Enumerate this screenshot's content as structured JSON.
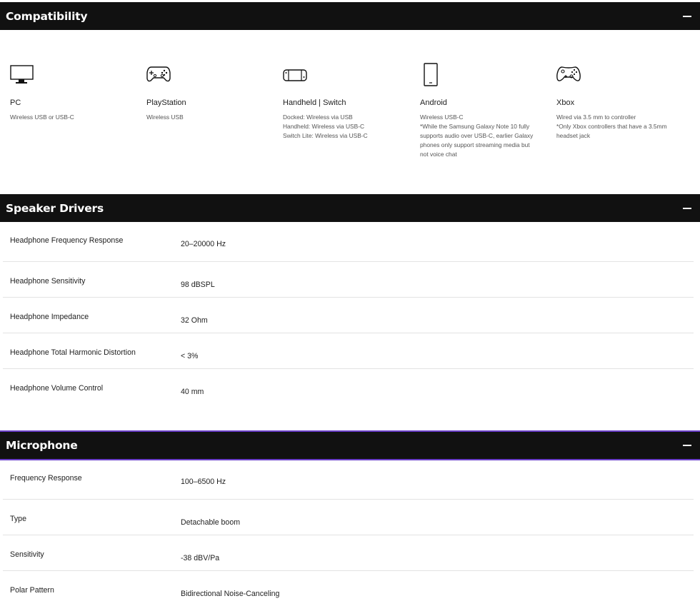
{
  "compatibility": {
    "title": "Compatibility",
    "items": [
      {
        "icon": "monitor-icon",
        "name": "PC",
        "desc": [
          "Wireless USB or USB-C"
        ]
      },
      {
        "icon": "gamepad-icon",
        "name": "PlayStation",
        "desc": [
          "Wireless USB"
        ]
      },
      {
        "icon": "handheld-console-icon",
        "name": "Handheld | Switch",
        "desc": [
          "Docked: Wireless via USB",
          "Handheld: Wireless via USB-C",
          "Switch Lite: Wireless via USB-C"
        ]
      },
      {
        "icon": "smartphone-icon",
        "name": "Android",
        "desc": [
          "Wireless USB-C",
          "*While the Samsung Galaxy Note 10 fully",
          "supports audio over USB-C, earlier Galaxy",
          "phones only support streaming media but",
          "not voice chat"
        ]
      },
      {
        "icon": "xbox-controller-icon",
        "name": "Xbox",
        "desc": [
          "Wired via 3.5 mm to controller",
          "*Only Xbox controllers that have a 3.5mm",
          "headset jack"
        ]
      }
    ]
  },
  "speaker": {
    "title": "Speaker Drivers",
    "rows": [
      {
        "label": "Headphone Frequency Response",
        "value": "20–20000 Hz"
      },
      {
        "label": "Headphone Sensitivity",
        "value": "98 dBSPL"
      },
      {
        "label": "Headphone Impedance",
        "value": "32 Ohm"
      },
      {
        "label": "Headphone Total Harmonic Distortion",
        "value": "< 3%"
      },
      {
        "label": "Headphone Volume Control",
        "value": "40 mm"
      }
    ]
  },
  "microphone": {
    "title": "Microphone",
    "rows": [
      {
        "label": "Frequency Response",
        "value": "100–6500 Hz"
      },
      {
        "label": "Type",
        "value": "Detachable boom"
      },
      {
        "label": "Sensitivity",
        "value": "-38 dBV/Pa"
      },
      {
        "label": "Polar Pattern",
        "value": "Bidirectional Noise-Canceling"
      }
    ]
  },
  "colors": {
    "header_bg": "#111111",
    "accent": "#6a3fc9"
  }
}
